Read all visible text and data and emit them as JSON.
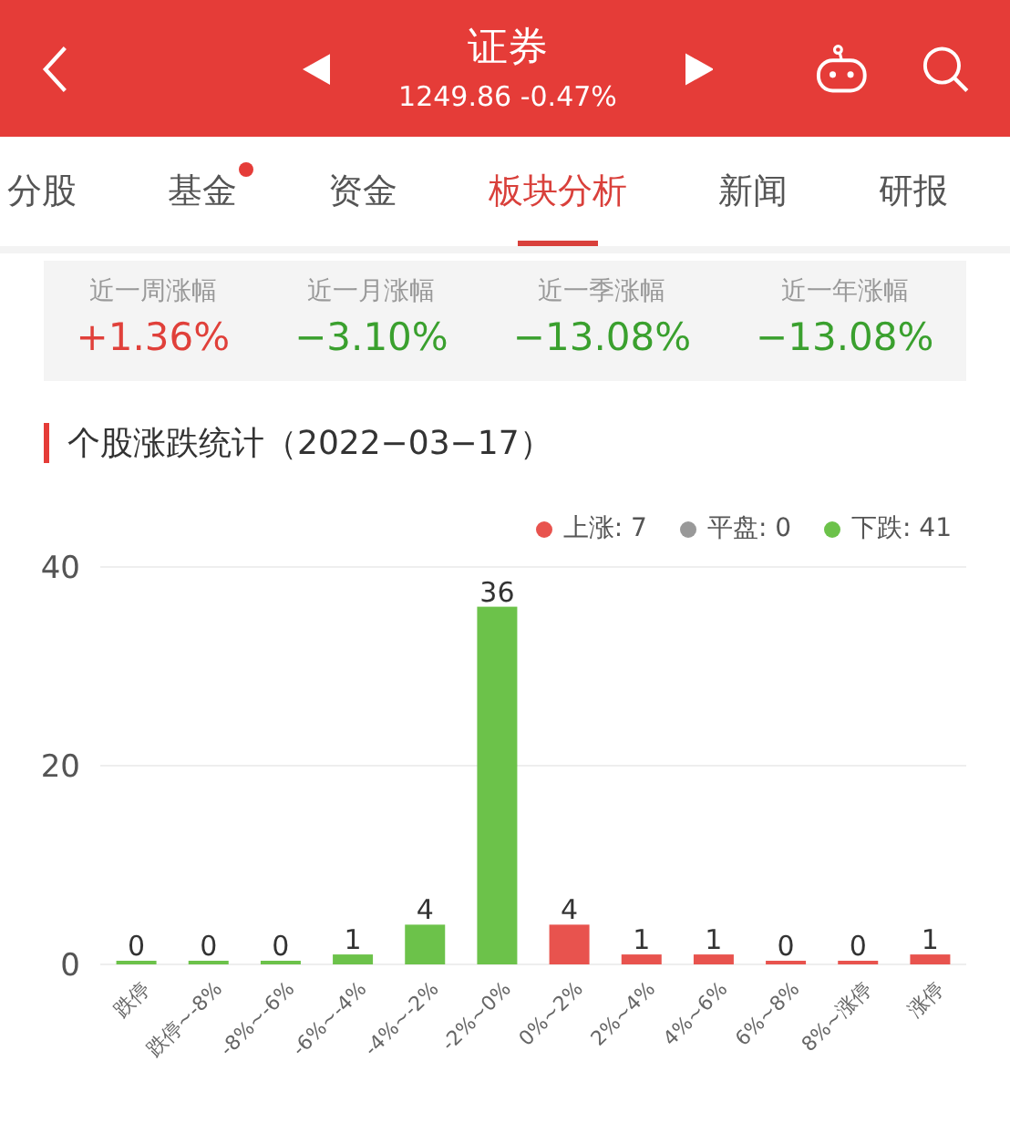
{
  "header": {
    "title": "证券",
    "quote": "1249.86 -0.47%"
  },
  "tabs": [
    {
      "label": "分股",
      "selected": false,
      "dot": false
    },
    {
      "label": "基金",
      "selected": false,
      "dot": true
    },
    {
      "label": "资金",
      "selected": false,
      "dot": false
    },
    {
      "label": "板块分析",
      "selected": true,
      "dot": false
    },
    {
      "label": "新闻",
      "selected": false,
      "dot": false
    },
    {
      "label": "研报",
      "selected": false,
      "dot": false
    }
  ],
  "performance": [
    {
      "label": "近一周涨幅",
      "value": "+1.36%",
      "color": "#e0403a"
    },
    {
      "label": "近一月涨幅",
      "value": "−3.10%",
      "color": "#3aa02e"
    },
    {
      "label": "近一季涨幅",
      "value": "−13.08%",
      "color": "#3aa02e"
    },
    {
      "label": "近一年涨幅",
      "value": "−13.08%",
      "color": "#3aa02e"
    }
  ],
  "section_title": "个股涨跌统计（2022−03−17）",
  "legend": [
    {
      "label": "上涨: 7",
      "color": "#e8534e"
    },
    {
      "label": "平盘: 0",
      "color": "#999999"
    },
    {
      "label": "下跌: 41",
      "color": "#6cc24a"
    }
  ],
  "chart_data": {
    "type": "bar",
    "stacked": true,
    "data_labels": true,
    "categories": [
      "跌停",
      "跌停~-8%",
      "-8%~-6%",
      "-6%~-4%",
      "-4%~-2%",
      "-2%~0%",
      "0%~2%",
      "2%~4%",
      "4%~6%",
      "6%~8%",
      "8%~涨停",
      "涨停"
    ],
    "ylim": [
      0,
      40
    ],
    "yticks": [
      0,
      20,
      40
    ],
    "series": [
      {
        "color": "#6cc24a",
        "values": [
          0,
          0,
          0,
          1,
          4,
          36,
          null,
          null,
          null,
          null,
          null,
          null
        ]
      },
      {
        "color": "#e8534e",
        "values": [
          null,
          null,
          null,
          null,
          null,
          null,
          4,
          1,
          1,
          0,
          0,
          1
        ]
      }
    ]
  }
}
